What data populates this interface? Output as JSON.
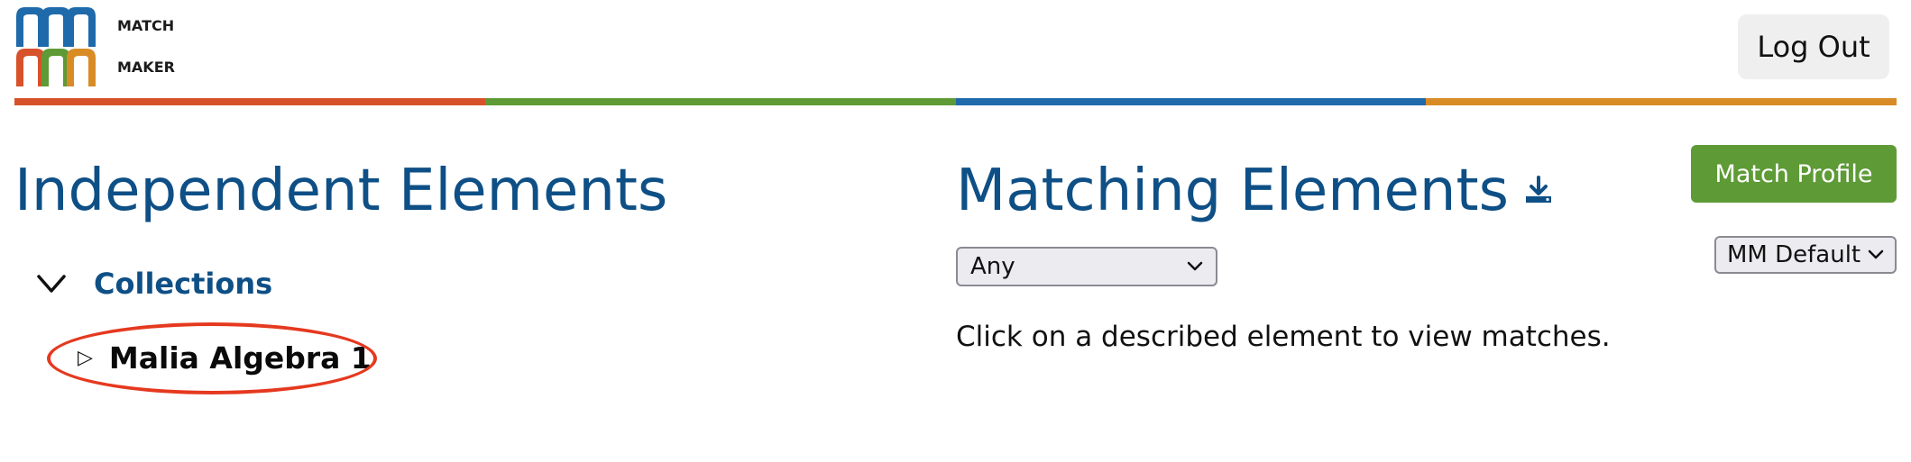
{
  "header": {
    "logo_line1": "MATCH",
    "logo_line2": "MAKER",
    "logout_label": "Log Out"
  },
  "brand_colors": {
    "orange_red": "#d7522a",
    "green": "#5e9a36",
    "blue": "#1f6aab",
    "orange": "#d98b26",
    "title_blue": "#0e4f86",
    "highlight_red": "#e5391f"
  },
  "independent": {
    "title": "Independent Elements",
    "collections_label": "Collections",
    "items": [
      {
        "label": "Malia Algebra 1"
      }
    ]
  },
  "matching": {
    "title": "Matching Elements",
    "download_icon": "download-icon",
    "filter_selected": "Any",
    "hint": "Click on a described element to view matches.",
    "match_profile_label": "Match Profile",
    "profile_selected": "MM Default"
  }
}
